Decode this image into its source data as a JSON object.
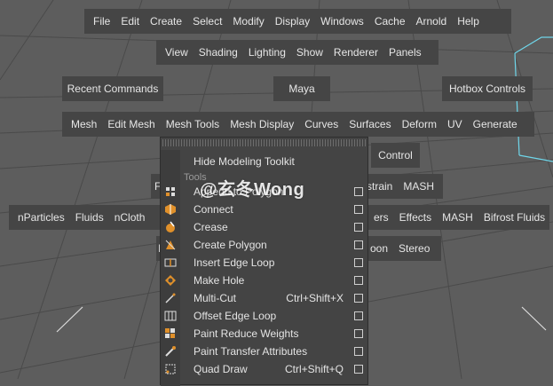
{
  "top_menu": [
    "File",
    "Edit",
    "Create",
    "Select",
    "Modify",
    "Display",
    "Windows",
    "Cache",
    "Arnold",
    "Help"
  ],
  "view_menu": [
    "View",
    "Shading",
    "Lighting",
    "Show",
    "Renderer",
    "Panels"
  ],
  "recent_commands": "Recent Commands",
  "maya": "Maya",
  "hotbox_controls": "Hotbox Controls",
  "modeling_menu": [
    "Mesh",
    "Edit Mesh",
    "Mesh Tools",
    "Mesh Display",
    "Curves",
    "Surfaces",
    "Deform",
    "UV",
    "Generate"
  ],
  "control": "Control",
  "partial_row_1": {
    "left": "F",
    "right": [
      "strain",
      "MASH"
    ]
  },
  "left_row": [
    "nParticles",
    "Fluids",
    "nCloth"
  ],
  "right_row": [
    "ers",
    "Effects",
    "MASH",
    "Bifrost Fluids"
  ],
  "partial_row_2": {
    "left": "I",
    "right": [
      "oon",
      "Stereo"
    ]
  },
  "menu": {
    "header_item": "Hide Modeling Toolkit",
    "section": "Tools",
    "items": [
      {
        "label": "Append to Polygon",
        "hotkey": "",
        "icon": "append-polygon-icon"
      },
      {
        "label": "Connect",
        "hotkey": "",
        "icon": "connect-icon"
      },
      {
        "label": "Crease",
        "hotkey": "",
        "icon": "crease-icon"
      },
      {
        "label": "Create Polygon",
        "hotkey": "",
        "icon": "create-polygon-icon"
      },
      {
        "label": "Insert Edge Loop",
        "hotkey": "",
        "icon": "insert-edge-loop-icon"
      },
      {
        "label": "Make Hole",
        "hotkey": "",
        "icon": "make-hole-icon"
      },
      {
        "label": "Multi-Cut",
        "hotkey": "Ctrl+Shift+X",
        "icon": "multi-cut-icon"
      },
      {
        "label": "Offset Edge Loop",
        "hotkey": "",
        "icon": "offset-edge-loop-icon"
      },
      {
        "label": "Paint Reduce Weights",
        "hotkey": "",
        "icon": "paint-reduce-weights-icon"
      },
      {
        "label": "Paint Transfer Attributes",
        "hotkey": "",
        "icon": "paint-transfer-attributes-icon"
      },
      {
        "label": "Quad Draw",
        "hotkey": "Ctrl+Shift+Q",
        "icon": "quad-draw-icon"
      }
    ]
  },
  "watermark": "@玄冬Wong",
  "colors": {
    "background": "#5d5d5d",
    "panel": "#454545",
    "accent_orange": "#e0902a",
    "cube_outline": "#6fd6ea"
  }
}
